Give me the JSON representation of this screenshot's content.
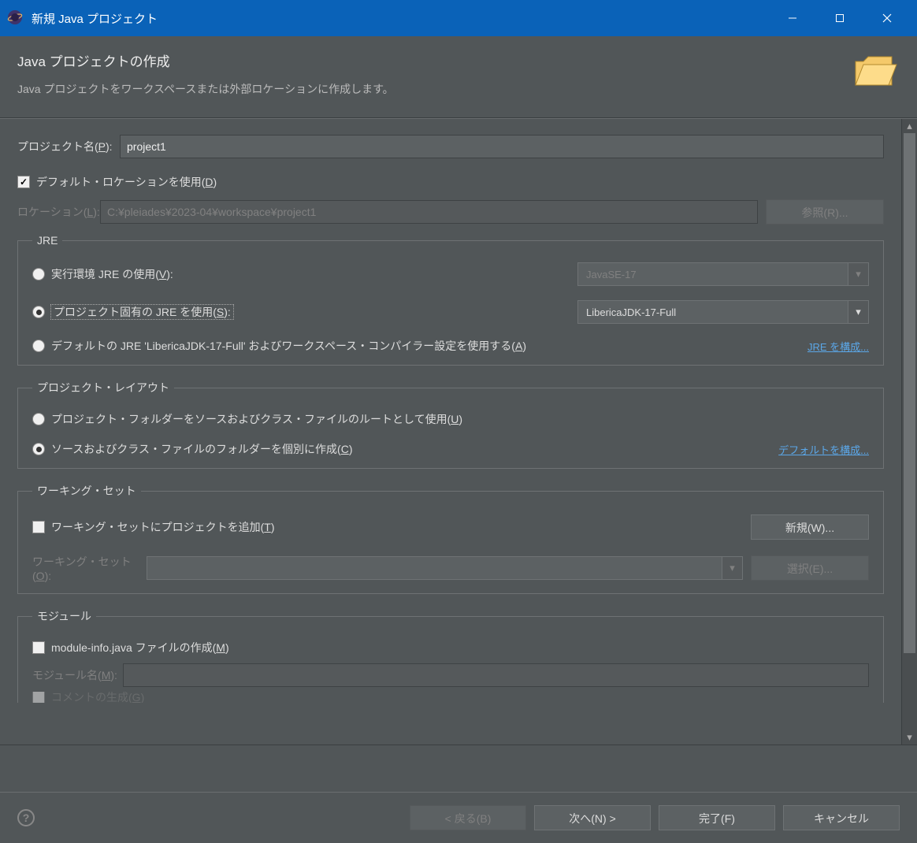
{
  "titlebar": {
    "title": "新規 Java プロジェクト"
  },
  "header": {
    "title": "Java プロジェクトの作成",
    "description": "Java プロジェクトをワークスペースまたは外部ロケーションに作成します。"
  },
  "project": {
    "name_label": "プロジェクト名(",
    "name_mn": "P",
    "name_label_after": "):",
    "name_value": "project1",
    "use_default_label": "デフォルト・ロケーションを使用(",
    "use_default_mn": "D",
    "use_default_after": ")",
    "use_default_checked": true,
    "location_label": "ロケーション(",
    "location_mn": "L",
    "location_after": "):",
    "location_value": "C:¥pleiades¥2023-04¥workspace¥project1",
    "browse_label": "参照(",
    "browse_mn": "R",
    "browse_after": ")..."
  },
  "jre": {
    "legend": "JRE",
    "exec_env_label": "実行環境 JRE の使用(",
    "exec_env_mn": "V",
    "exec_env_after": "):",
    "exec_env_value": "JavaSE-17",
    "project_jre_label": "プロジェクト固有の JRE を使用(",
    "project_jre_mn": "S",
    "project_jre_after": "):",
    "project_jre_value": "LibericaJDK-17-Full",
    "default_jre_label": "デフォルトの JRE 'LibericaJDK-17-Full' およびワークスペース・コンパイラー設定を使用する(",
    "default_jre_mn": "A",
    "default_jre_after": ")",
    "configure_link": "JRE を構成..."
  },
  "layout": {
    "legend": "プロジェクト・レイアウト",
    "root_label": "プロジェクト・フォルダーをソースおよびクラス・ファイルのルートとして使用(",
    "root_mn": "U",
    "root_after": ")",
    "separate_label": "ソースおよびクラス・ファイルのフォルダーを個別に作成(",
    "separate_mn": "C",
    "separate_after": ")",
    "configure_link": "デフォルトを構成..."
  },
  "workingset": {
    "legend": "ワーキング・セット",
    "add_label": "ワーキング・セットにプロジェクトを追加(",
    "add_mn": "T",
    "add_after": ")",
    "new_label": "新規(",
    "new_mn": "W",
    "new_after": ")...",
    "ws_label": "ワーキング・セット(",
    "ws_mn": "O",
    "ws_after": "):",
    "select_label": "選択(",
    "select_mn": "E",
    "select_after": ")..."
  },
  "module": {
    "legend": "モジュール",
    "create_label": "module-info.java ファイルの作成(",
    "create_mn": "M",
    "create_after": ")",
    "modname_label": "モジュール名(",
    "modname_mn": "M",
    "modname_after": "):",
    "comment_label": "コメントの生成(",
    "comment_mn": "G",
    "comment_after": ")"
  },
  "footer": {
    "back": "< 戻る(",
    "back_mn": "B",
    "back_after": ")",
    "next": "次へ(",
    "next_mn": "N",
    "next_after": ") >",
    "finish": "完了(",
    "finish_mn": "F",
    "finish_after": ")",
    "cancel": "キャンセル"
  }
}
